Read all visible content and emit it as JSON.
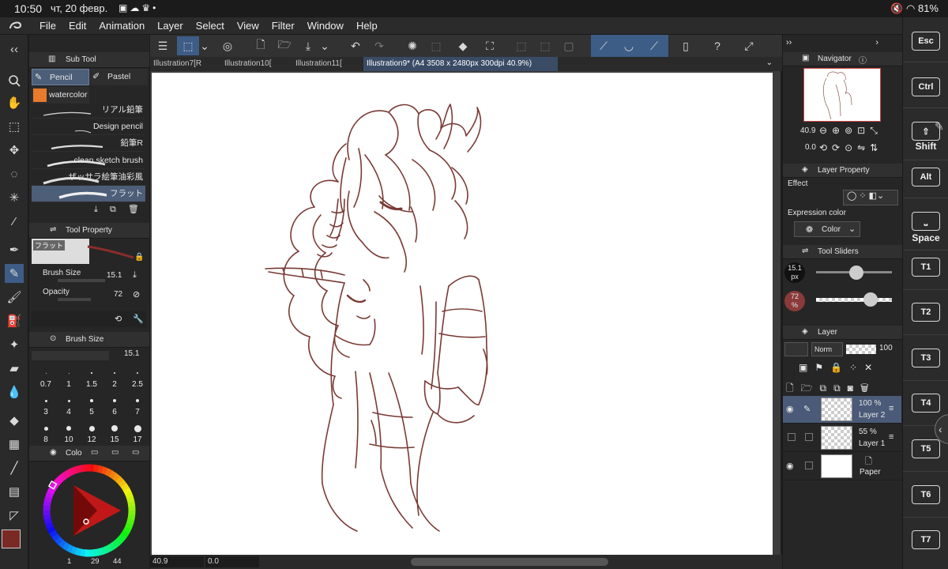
{
  "status_bar": {
    "time": "10:50",
    "date": "чт, 20 февр.",
    "icons": [
      "gallery-icon",
      "cloud-icon",
      "crown-icon",
      "dot-icon"
    ],
    "battery": "81%"
  },
  "menu": {
    "items": [
      "File",
      "Edit",
      "Animation",
      "Layer",
      "Select",
      "View",
      "Filter",
      "Window",
      "Help"
    ]
  },
  "tabs": [
    {
      "label": "Illustration7[R"
    },
    {
      "label": "Illustration10["
    },
    {
      "label": "Illustration11["
    },
    {
      "label": "Illustration9* (A4 3508 x 2480px 300dpi 40.9%)"
    }
  ],
  "subtool": {
    "title": "Sub Tool",
    "groups": [
      "Pencil",
      "Pastel",
      "watercolor"
    ],
    "brushes": [
      "リアル鉛筆",
      "Design pencil",
      "鉛筆R",
      "clean sketch brush",
      "ザッサラ絵筆油彩風",
      "フラット"
    ]
  },
  "tool_property": {
    "title": "Tool Property",
    "preview_name": "フラット",
    "brush_size_label": "Brush Size",
    "brush_size_value": "15.1",
    "opacity_label": "Opacity",
    "opacity_value": "72"
  },
  "brush_size_panel": {
    "title": "Brush Size",
    "value": "15.1",
    "presets": [
      "0.7",
      "1",
      "1.5",
      "2",
      "2.5",
      "3",
      "4",
      "5",
      "6",
      "7",
      "8",
      "10",
      "12",
      "15",
      "17"
    ]
  },
  "color_panel": {
    "title": "Colo",
    "main_color": "#7a2a24",
    "sub_color": "#ffffff",
    "footer": [
      "1",
      "29",
      "44"
    ]
  },
  "navigator": {
    "title": "Navigator",
    "zoom": "40.9",
    "rotation": "0.0"
  },
  "layer_property": {
    "title": "Layer Property",
    "effect_label": "Effect",
    "expression_label": "Expression color",
    "expression_value": "Color"
  },
  "tool_sliders": {
    "title": "Tool Sliders",
    "size_value": "15.1",
    "size_unit": "px",
    "size_level": 0.53,
    "opacity_value": "72",
    "opacity_unit": "%",
    "opacity_level": 0.72
  },
  "layers": {
    "title": "Layer",
    "blend_mode": "Norm",
    "opacity": "100",
    "items": [
      {
        "opacity": "100 %",
        "name": "Layer 2"
      },
      {
        "opacity": "55 %",
        "name": "Layer 1"
      },
      {
        "opacity": "",
        "name": "Paper"
      }
    ]
  },
  "bottom_bar": {
    "zoom": "40.9",
    "angle": "0.0"
  },
  "keys": {
    "esc": "Esc",
    "ctrl": "Ctrl",
    "shift": "Shift",
    "alt": "Alt",
    "space": "Space",
    "t": [
      "T1",
      "T2",
      "T3",
      "T4",
      "T5",
      "T6",
      "T7"
    ]
  },
  "colors": {
    "accent": "#3d5d86",
    "line": "#7a3a34"
  }
}
